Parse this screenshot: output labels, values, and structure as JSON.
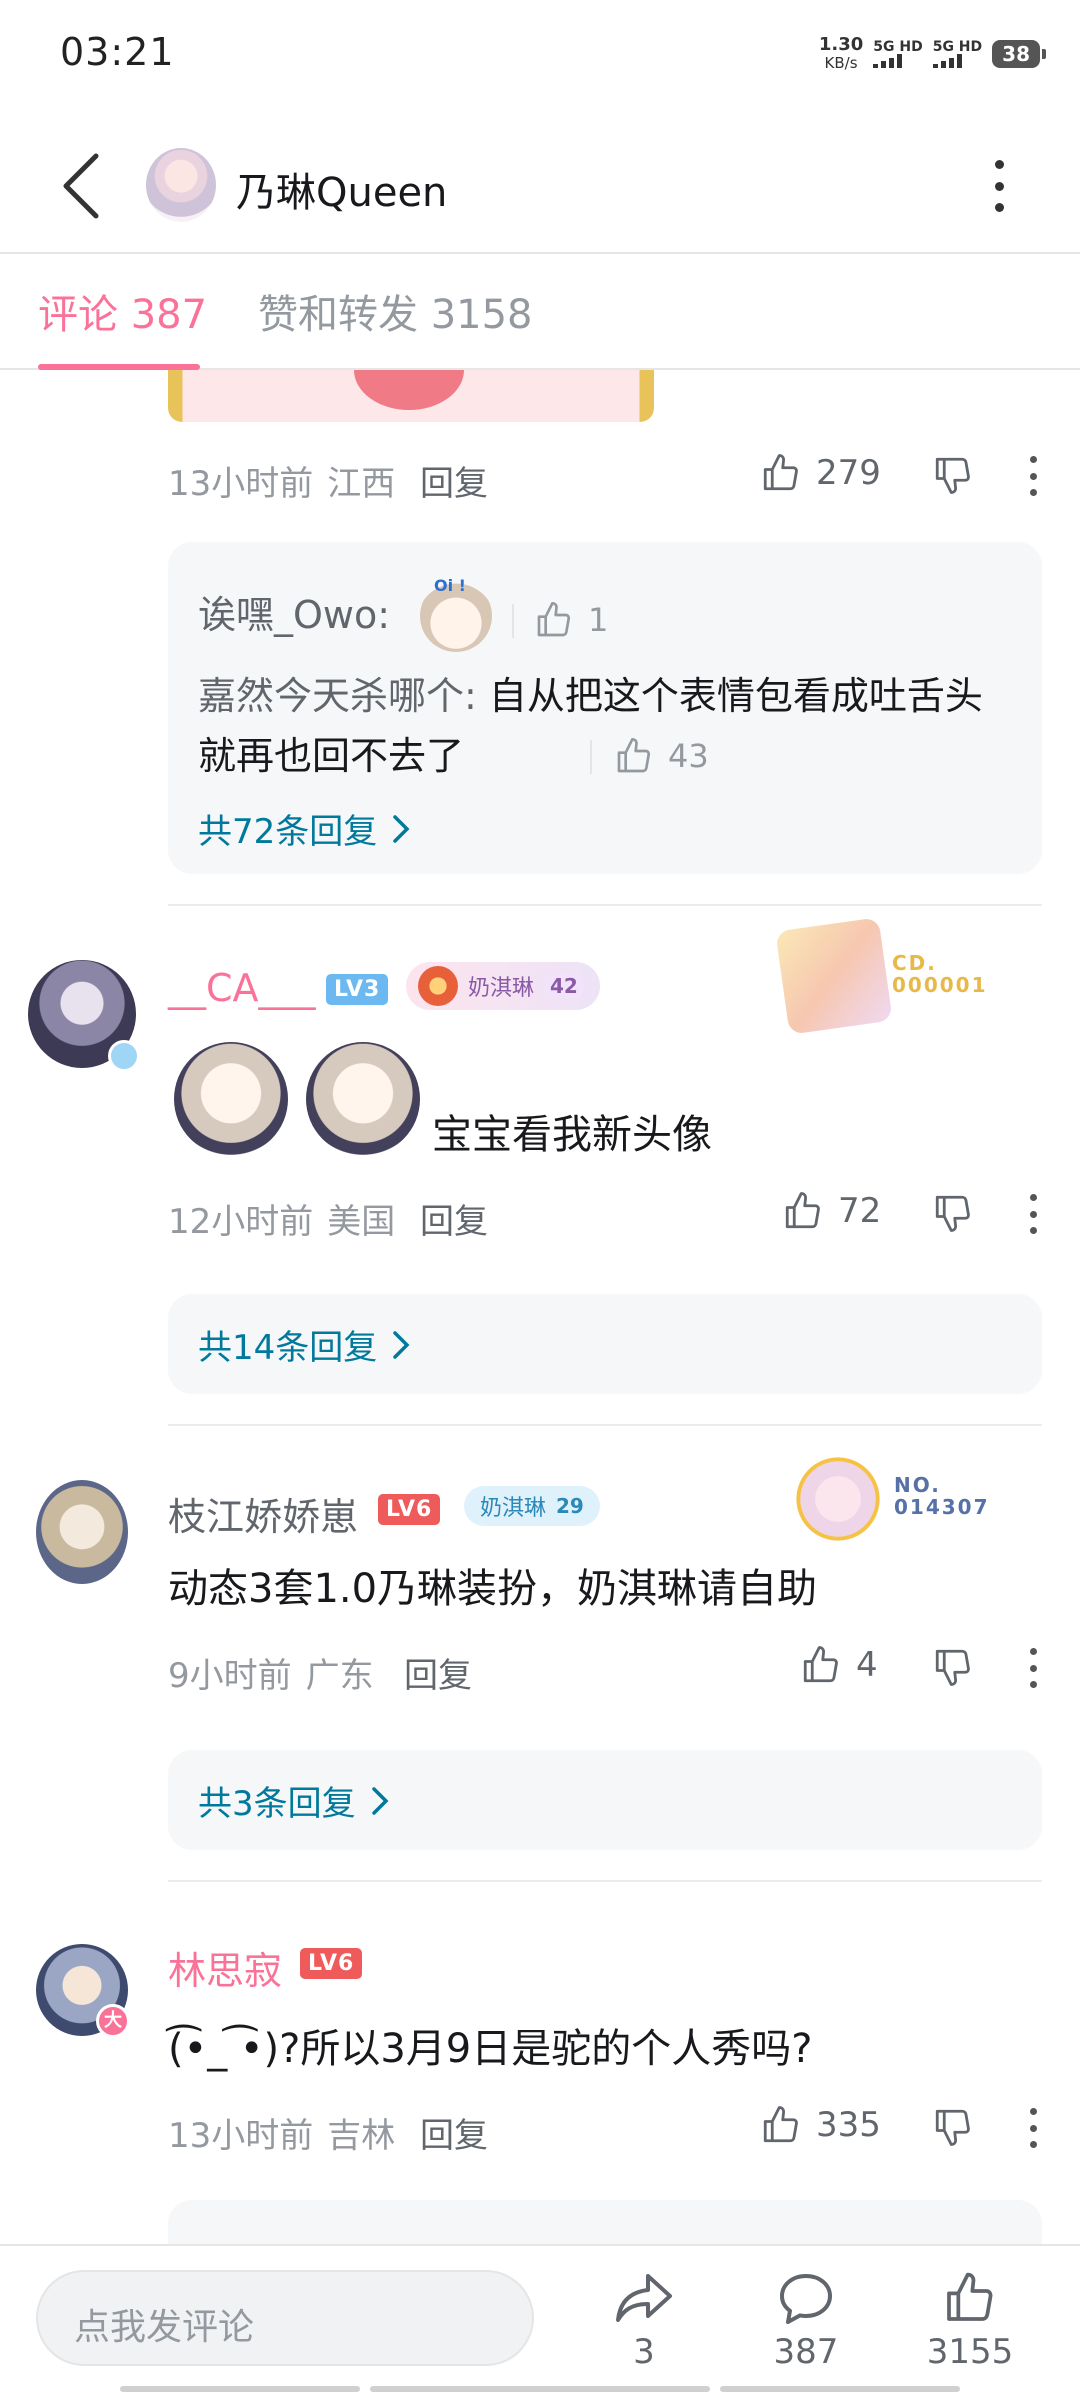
{
  "status": {
    "time": "03:21",
    "net_speed_value": "1.30",
    "net_speed_unit": "KB/s",
    "sim1": "5G HD",
    "sim2": "5G HD",
    "battery": "38"
  },
  "header": {
    "title": "乃琳Queen"
  },
  "tabs": [
    {
      "label": "评论 387",
      "active": true
    },
    {
      "label": "赞和转发 3158",
      "active": false
    }
  ],
  "comments": [
    {
      "id": "c0",
      "time": "13小时前",
      "location": "江西",
      "reply_label": "回复",
      "likes": "279",
      "sub_replies": [
        {
          "user": "诶嘿_Owo:",
          "text": "",
          "likes": "1",
          "sticker_text": "Oi !"
        },
        {
          "user": "嘉然今天杀哪个:",
          "text": "自从把这个表情包看成吐舌头就再也回不去了",
          "likes": "43"
        }
      ],
      "more_replies": "共72条回复"
    },
    {
      "id": "c1",
      "user": "__CA___",
      "level": "LV3",
      "level_color": "#6bb9f0",
      "fan_name": "奶淇琳",
      "fan_level": "42",
      "card_no_label": "CD.",
      "card_no": "000001",
      "text": "宝宝看我新头像",
      "time": "12小时前",
      "location": "美国",
      "reply_label": "回复",
      "likes": "72",
      "more_replies": "共14条回复"
    },
    {
      "id": "c2",
      "user": "枝江娇娇崽",
      "level": "LV6",
      "level_color": "#ef5a5a",
      "fan_name": "奶淇琳",
      "fan_level": "29",
      "card_no_label": "NO.",
      "card_no": "014307",
      "text": "动态3套1.0乃琳装扮，奶淇琳请自助",
      "time": "9小时前",
      "location": "广东",
      "reply_label": "回复",
      "likes": "4",
      "more_replies": "共3条回复"
    },
    {
      "id": "c3",
      "user": "林思寂",
      "level": "LV6",
      "level_color": "#ef5a5a",
      "avatar_badge": "大",
      "text": "(͡•_ ͡•)?所以3月9日是驼的个人秀吗?",
      "time": "13小时前",
      "location": "吉林",
      "reply_label": "回复",
      "likes": "335"
    }
  ],
  "bottom": {
    "input_placeholder": "点我发评论",
    "share_count": "3",
    "comment_count": "387",
    "like_count": "3155"
  },
  "colors": {
    "accent": "#fb7299",
    "link": "#00799d",
    "muted": "#9499a0"
  }
}
